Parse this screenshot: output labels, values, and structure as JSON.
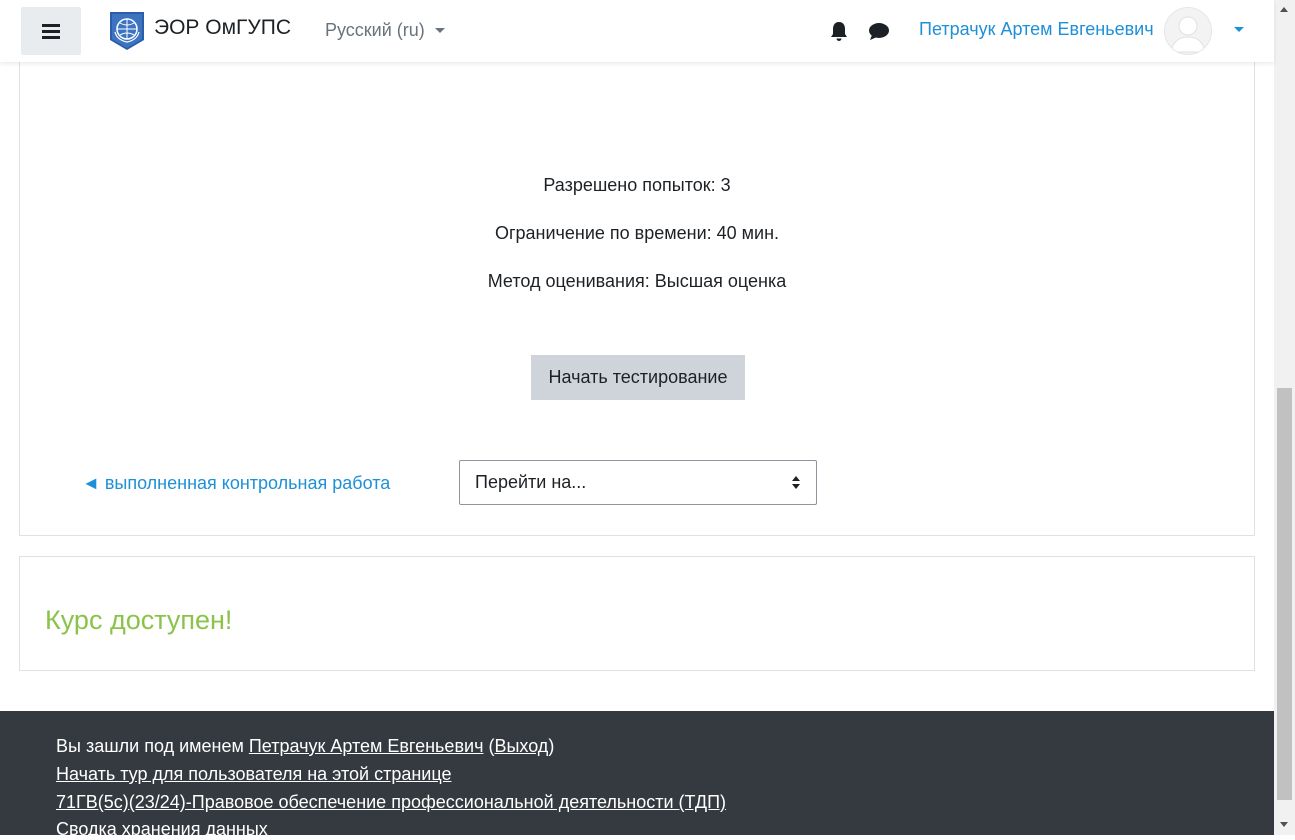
{
  "header": {
    "site_name": "ЭОР ОмГУПС",
    "language": "Русский (ru)",
    "user_name": "Петрачук Артем Евгеньевич"
  },
  "quiz": {
    "attempts_allowed": "Разрешено попыток: 3",
    "time_limit": "Ограничение по времени: 40 мин.",
    "grading_method": "Метод оценивания: Высшая оценка",
    "start_button": "Начать тестирование",
    "prev_activity_link": "◄ выполненная контрольная работа",
    "jump_to_placeholder": "Перейти на..."
  },
  "notice": {
    "text": "Курс доступен!"
  },
  "footer": {
    "logged_in_prefix": "Вы зашли под именем ",
    "logged_in_user": "Петрачук Артем Евгеньевич",
    "logout_open": " (",
    "logout": "Выход",
    "logout_close": ")",
    "tour_link": "Начать тур для пользователя на этой странице",
    "course_link": "71ГВ(5с)(23/24)-Правовое обеспечение профессиональной деятельности (ТДП)",
    "data_retention_link": "Сводка хранения данных"
  },
  "colors": {
    "link": "#1e90d8",
    "notice": "#8bc34a",
    "footer_bg": "#343a40",
    "button_bg": "#ced4da"
  },
  "icons": [
    "menu-icon",
    "site-logo",
    "caret-down-icon",
    "bell-icon",
    "chat-icon",
    "user-avatar-icon",
    "select-updown-icon"
  ]
}
